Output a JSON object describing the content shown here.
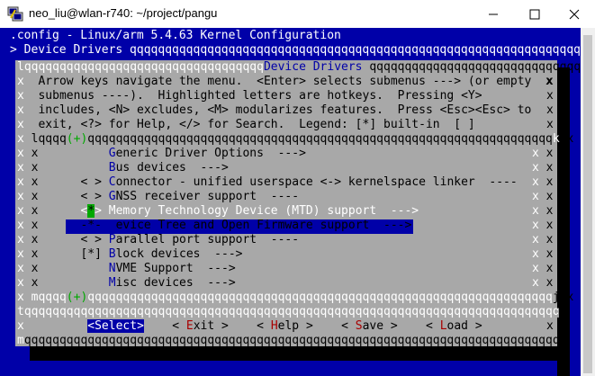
{
  "window": {
    "title": "neo_liu@wlan-r740: ~/project/pangu"
  },
  "header": {
    "config_title": ".config - Linux/arm 5.4.63 Kernel Configuration",
    "breadcrumb": "> Device Drivers"
  },
  "dialog": {
    "title": "Device Drivers",
    "help_lines": [
      "Arrow keys navigate the menu.  <Enter> selects submenus ---> (or empty",
      "submenus ----).  Highlighted letters are hotkeys.  Pressing <Y>",
      "includes, <N> excludes, <M> modularizes features.  Press <Esc><Esc> to",
      "exit, <?> for Help, </> for Search.  Legend: [*] built-in  [ ]"
    ]
  },
  "menu": {
    "items": [
      {
        "prefix": "    ",
        "hot": "G",
        "rest": "eneric Driver Options  --->"
      },
      {
        "prefix": "    ",
        "hot": "B",
        "rest": "us devices  --->"
      },
      {
        "prefix": "< > ",
        "hot": "C",
        "rest": "onnector - unified userspace <-> kernelspace linker  ----"
      },
      {
        "prefix": "< > ",
        "hot": "G",
        "rest": "NSS receiver support  ----"
      },
      {
        "prefix": "<",
        "hot": "*",
        "mid": "> ",
        "rest": "Memory Technology Device (MTD) support  --->",
        "selected": true
      },
      {
        "prefix": "-*- ",
        "hot": "D",
        "rest": "evice Tree and Open Firmware support  --->"
      },
      {
        "prefix": "< > ",
        "hot": "P",
        "rest": "arallel port support  ----"
      },
      {
        "prefix": "[*] ",
        "hot": "B",
        "rest": "lock devices  --->"
      },
      {
        "prefix": "    ",
        "hot": "N",
        "rest": "VME Support  --->"
      },
      {
        "prefix": "    ",
        "hot": "M",
        "rest": "isc devices  --->"
      }
    ]
  },
  "buttons": {
    "select": "<Select>",
    "exit_hot": "E",
    "exit_rest": "xit",
    "help_hot": "H",
    "help_rest": "elp",
    "save_hot": "S",
    "save_rest": "ave",
    "load_hot": "L",
    "load_rest": "oad"
  }
}
